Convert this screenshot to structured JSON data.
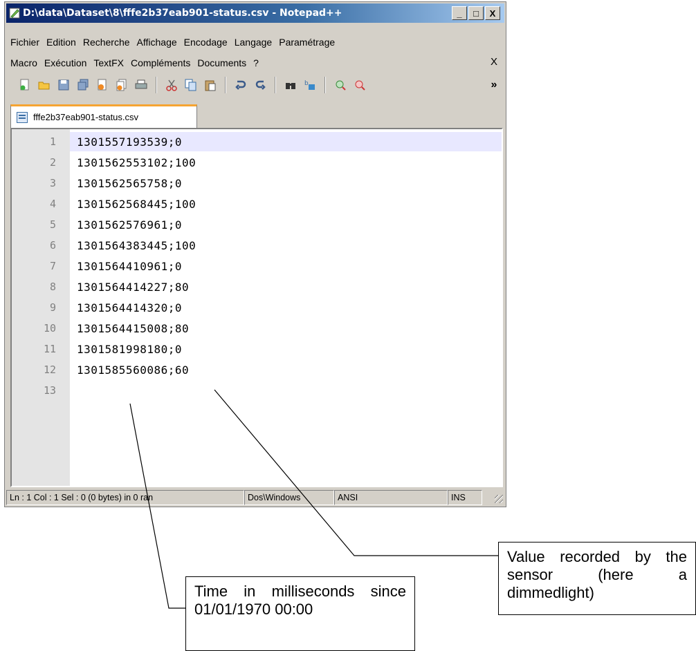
{
  "window": {
    "title": "D:\\data\\Dataset\\8\\fffe2b37eab901-status.csv - Notepad++",
    "buttons": {
      "minimize": "_",
      "maximize": "□",
      "close": "X"
    }
  },
  "menu": {
    "row1": [
      "Fichier",
      "Edition",
      "Recherche",
      "Affichage",
      "Encodage",
      "Langage",
      "Paramétrage"
    ],
    "row2": [
      "Macro",
      "Exécution",
      "TextFX",
      "Compléments",
      "Documents",
      "?"
    ],
    "close": "X"
  },
  "toolbar": {
    "icons": [
      "new-file-icon",
      "open-file-icon",
      "save-icon",
      "save-all-icon",
      "close-icon",
      "close-all-icon",
      "print-icon",
      "cut-icon",
      "copy-icon",
      "paste-icon",
      "undo-icon",
      "redo-icon",
      "find-icon",
      "replace-icon",
      "zoom-in-icon",
      "zoom-out-icon"
    ],
    "overflow": "»"
  },
  "tab": {
    "label": "fffe2b37eab901-status.csv"
  },
  "editor": {
    "lines": [
      {
        "num": "1",
        "text": "1301557193539;0"
      },
      {
        "num": "2",
        "text": "1301562553102;100"
      },
      {
        "num": "3",
        "text": "1301562565758;0"
      },
      {
        "num": "4",
        "text": "1301562568445;100"
      },
      {
        "num": "5",
        "text": "1301562576961;0"
      },
      {
        "num": "6",
        "text": "1301564383445;100"
      },
      {
        "num": "7",
        "text": "1301564410961;0"
      },
      {
        "num": "8",
        "text": "1301564414227;80"
      },
      {
        "num": "9",
        "text": "1301564414320;0"
      },
      {
        "num": "10",
        "text": "1301564415008;80"
      },
      {
        "num": "11",
        "text": "1301581998180;0"
      },
      {
        "num": "12",
        "text": "1301585560086;60"
      },
      {
        "num": "13",
        "text": ""
      }
    ],
    "current_line": 1
  },
  "statusbar": {
    "position": "Ln : 1    Col : 1    Sel : 0 (0 bytes) in 0 ran",
    "eol": "Dos\\Windows",
    "encoding": "ANSI",
    "mode": "INS"
  },
  "annotations": {
    "value_callout": "Value recorded by the sensor (here a dimmedlight)",
    "time_callout": "Time in milliseconds since 01/01/1970 00:00"
  }
}
